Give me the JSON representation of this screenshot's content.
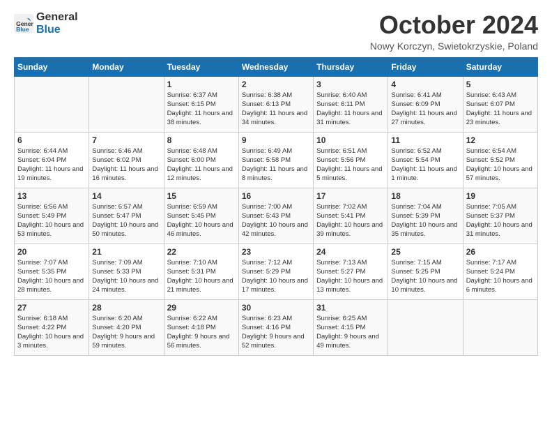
{
  "header": {
    "logo_general": "General",
    "logo_blue": "Blue",
    "month_title": "October 2024",
    "location": "Nowy Korczyn, Swietokrzyskie, Poland"
  },
  "columns": [
    "Sunday",
    "Monday",
    "Tuesday",
    "Wednesday",
    "Thursday",
    "Friday",
    "Saturday"
  ],
  "weeks": [
    [
      {
        "day": "",
        "info": ""
      },
      {
        "day": "",
        "info": ""
      },
      {
        "day": "1",
        "info": "Sunrise: 6:37 AM\nSunset: 6:15 PM\nDaylight: 11 hours and 38 minutes."
      },
      {
        "day": "2",
        "info": "Sunrise: 6:38 AM\nSunset: 6:13 PM\nDaylight: 11 hours and 34 minutes."
      },
      {
        "day": "3",
        "info": "Sunrise: 6:40 AM\nSunset: 6:11 PM\nDaylight: 11 hours and 31 minutes."
      },
      {
        "day": "4",
        "info": "Sunrise: 6:41 AM\nSunset: 6:09 PM\nDaylight: 11 hours and 27 minutes."
      },
      {
        "day": "5",
        "info": "Sunrise: 6:43 AM\nSunset: 6:07 PM\nDaylight: 11 hours and 23 minutes."
      }
    ],
    [
      {
        "day": "6",
        "info": "Sunrise: 6:44 AM\nSunset: 6:04 PM\nDaylight: 11 hours and 19 minutes."
      },
      {
        "day": "7",
        "info": "Sunrise: 6:46 AM\nSunset: 6:02 PM\nDaylight: 11 hours and 16 minutes."
      },
      {
        "day": "8",
        "info": "Sunrise: 6:48 AM\nSunset: 6:00 PM\nDaylight: 11 hours and 12 minutes."
      },
      {
        "day": "9",
        "info": "Sunrise: 6:49 AM\nSunset: 5:58 PM\nDaylight: 11 hours and 8 minutes."
      },
      {
        "day": "10",
        "info": "Sunrise: 6:51 AM\nSunset: 5:56 PM\nDaylight: 11 hours and 5 minutes."
      },
      {
        "day": "11",
        "info": "Sunrise: 6:52 AM\nSunset: 5:54 PM\nDaylight: 11 hours and 1 minute."
      },
      {
        "day": "12",
        "info": "Sunrise: 6:54 AM\nSunset: 5:52 PM\nDaylight: 10 hours and 57 minutes."
      }
    ],
    [
      {
        "day": "13",
        "info": "Sunrise: 6:56 AM\nSunset: 5:49 PM\nDaylight: 10 hours and 53 minutes."
      },
      {
        "day": "14",
        "info": "Sunrise: 6:57 AM\nSunset: 5:47 PM\nDaylight: 10 hours and 50 minutes."
      },
      {
        "day": "15",
        "info": "Sunrise: 6:59 AM\nSunset: 5:45 PM\nDaylight: 10 hours and 46 minutes."
      },
      {
        "day": "16",
        "info": "Sunrise: 7:00 AM\nSunset: 5:43 PM\nDaylight: 10 hours and 42 minutes."
      },
      {
        "day": "17",
        "info": "Sunrise: 7:02 AM\nSunset: 5:41 PM\nDaylight: 10 hours and 39 minutes."
      },
      {
        "day": "18",
        "info": "Sunrise: 7:04 AM\nSunset: 5:39 PM\nDaylight: 10 hours and 35 minutes."
      },
      {
        "day": "19",
        "info": "Sunrise: 7:05 AM\nSunset: 5:37 PM\nDaylight: 10 hours and 31 minutes."
      }
    ],
    [
      {
        "day": "20",
        "info": "Sunrise: 7:07 AM\nSunset: 5:35 PM\nDaylight: 10 hours and 28 minutes."
      },
      {
        "day": "21",
        "info": "Sunrise: 7:09 AM\nSunset: 5:33 PM\nDaylight: 10 hours and 24 minutes."
      },
      {
        "day": "22",
        "info": "Sunrise: 7:10 AM\nSunset: 5:31 PM\nDaylight: 10 hours and 21 minutes."
      },
      {
        "day": "23",
        "info": "Sunrise: 7:12 AM\nSunset: 5:29 PM\nDaylight: 10 hours and 17 minutes."
      },
      {
        "day": "24",
        "info": "Sunrise: 7:13 AM\nSunset: 5:27 PM\nDaylight: 10 hours and 13 minutes."
      },
      {
        "day": "25",
        "info": "Sunrise: 7:15 AM\nSunset: 5:25 PM\nDaylight: 10 hours and 10 minutes."
      },
      {
        "day": "26",
        "info": "Sunrise: 7:17 AM\nSunset: 5:24 PM\nDaylight: 10 hours and 6 minutes."
      }
    ],
    [
      {
        "day": "27",
        "info": "Sunrise: 6:18 AM\nSunset: 4:22 PM\nDaylight: 10 hours and 3 minutes."
      },
      {
        "day": "28",
        "info": "Sunrise: 6:20 AM\nSunset: 4:20 PM\nDaylight: 9 hours and 59 minutes."
      },
      {
        "day": "29",
        "info": "Sunrise: 6:22 AM\nSunset: 4:18 PM\nDaylight: 9 hours and 56 minutes."
      },
      {
        "day": "30",
        "info": "Sunrise: 6:23 AM\nSunset: 4:16 PM\nDaylight: 9 hours and 52 minutes."
      },
      {
        "day": "31",
        "info": "Sunrise: 6:25 AM\nSunset: 4:15 PM\nDaylight: 9 hours and 49 minutes."
      },
      {
        "day": "",
        "info": ""
      },
      {
        "day": "",
        "info": ""
      }
    ]
  ]
}
